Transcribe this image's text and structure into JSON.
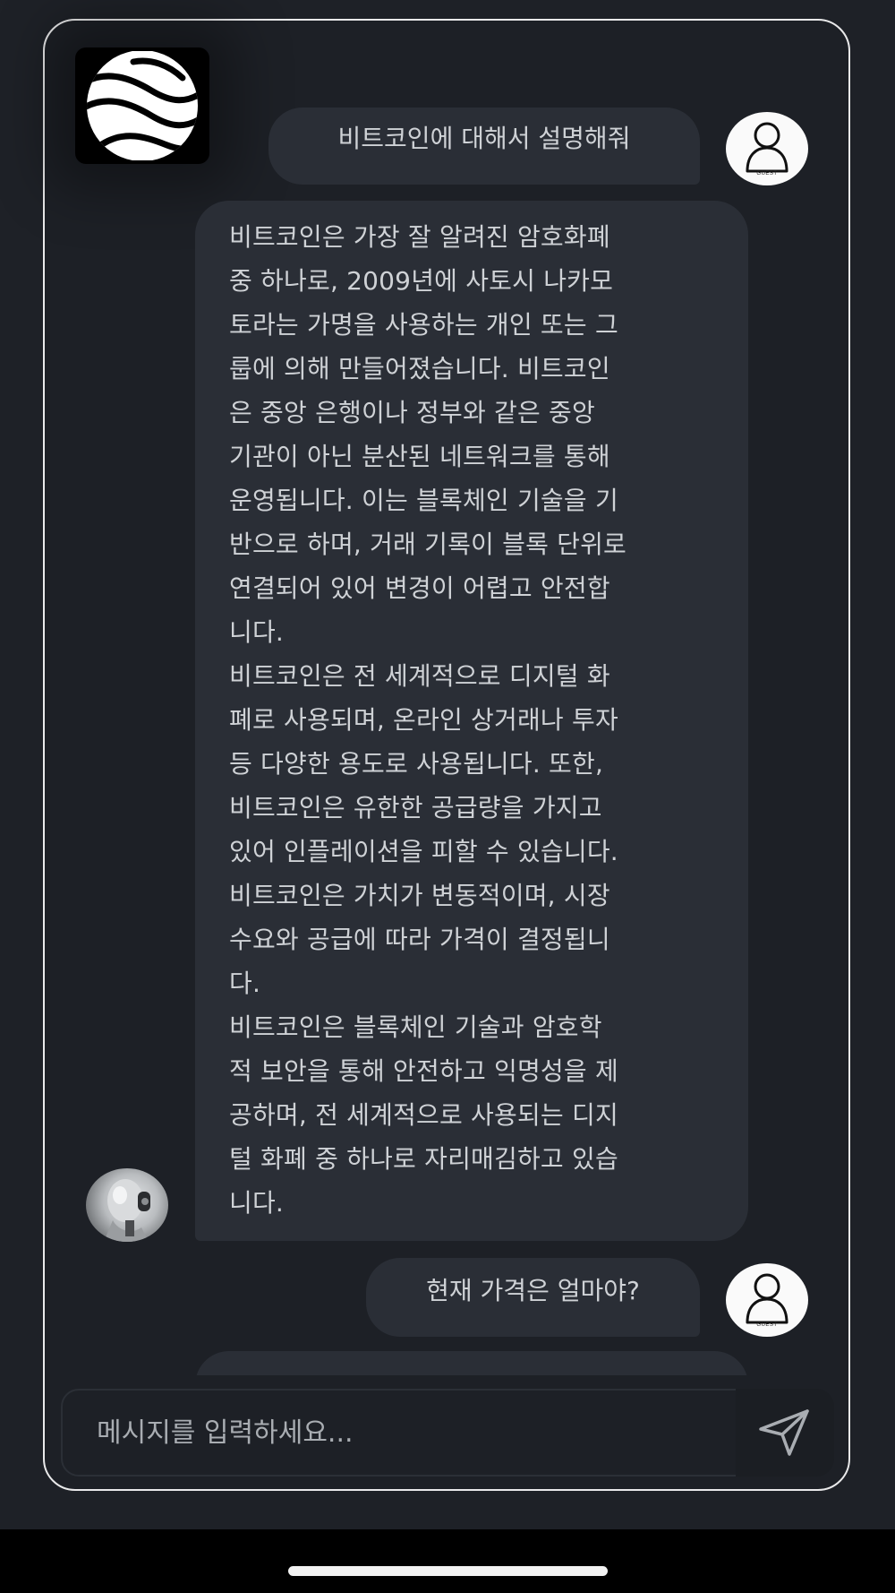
{
  "messages": [
    {
      "role": "user",
      "text": "비트코인에 대해서 설명해줘"
    },
    {
      "role": "assistant",
      "text": "비트코인은 가장 잘 알려진 암호화폐\n중 하나로, 2009년에 사토시 나카모\n토라는 가명을 사용하는 개인 또는 그\n룹에 의해 만들어졌습니다. 비트코인\n은 중앙 은행이나 정부와 같은 중앙\n기관이 아닌 분산된 네트워크를 통해\n운영됩니다. 이는 블록체인 기술을 기\n반으로 하며, 거래 기록이 블록 단위로\n연결되어 있어 변경이 어렵고 안전합\n니다.\n비트코인은 전 세계적으로 디지털 화\n폐로 사용되며, 온라인 상거래나 투자\n등 다양한 용도로 사용됩니다. 또한,\n비트코인은 유한한 공급량을 가지고\n있어 인플레이션을 피할 수 있습니다.\n비트코인은 가치가 변동적이며, 시장\n수요와 공급에 따라 가격이 결정됩니\n다.\n비트코인은 블록체인 기술과 암호학\n적 보안을 통해 안전하고 익명성을 제\n공하며, 전 세계적으로 사용되는 디지\n털 화폐 중 하나로 자리매김하고 있습\n니다."
    },
    {
      "role": "user",
      "text": "현재 가격은 얼마야?"
    }
  ],
  "guest_avatar_label": "GUEST",
  "input": {
    "placeholder": "메시지를 입력하세요..."
  },
  "icons": {
    "brand": "wave-globe-logo",
    "user": "guest-user-icon",
    "assistant": "robot-avatar",
    "send": "paper-plane-icon"
  },
  "colors": {
    "background": "#1e2127",
    "bubble": "#2a2e36",
    "text": "#cfd2d6",
    "frame_border": "#e9e9ea"
  }
}
